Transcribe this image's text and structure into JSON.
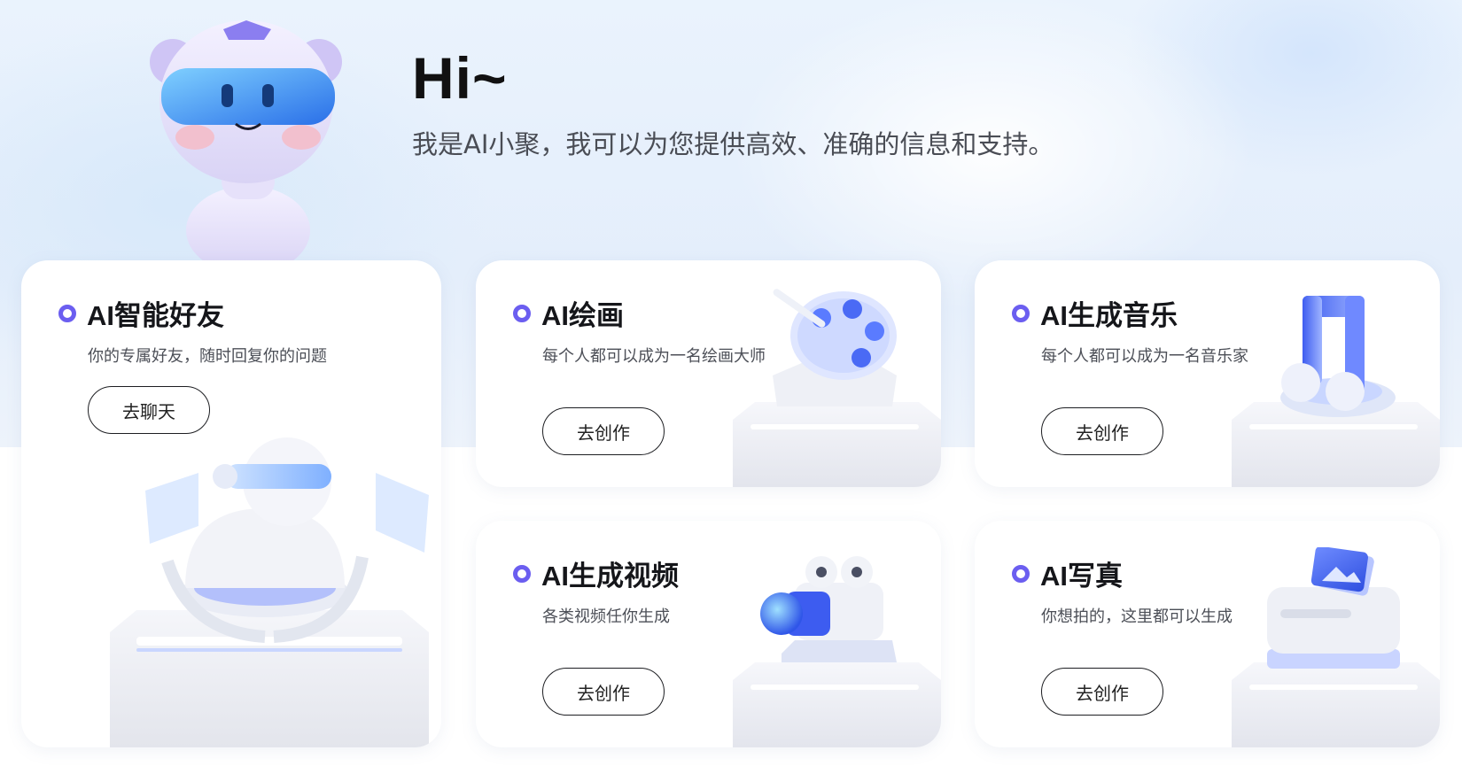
{
  "hero": {
    "greeting": "Hi~",
    "subtitle": "我是AI小聚，我可以为您提供高效、准确的信息和支持。"
  },
  "cards": [
    {
      "title": "AI智能好友",
      "desc": "你的专属好友，随时回复你的问题",
      "button": "去聊天",
      "icon": "robot-pedestal-icon"
    },
    {
      "title": "AI绘画",
      "desc": "每个人都可以成为一名绘画大师",
      "button": "去创作",
      "icon": "palette-icon"
    },
    {
      "title": "AI生成音乐",
      "desc": "每个人都可以成为一名音乐家",
      "button": "去创作",
      "icon": "music-note-icon"
    },
    {
      "title": "AI生成视频",
      "desc": "各类视频任你生成",
      "button": "去创作",
      "icon": "video-camera-icon"
    },
    {
      "title": "AI写真",
      "desc": "你想拍的，这里都可以生成",
      "button": "去创作",
      "icon": "photo-printer-icon"
    }
  ],
  "colors": {
    "accent": "#6b5ef0",
    "blue": "#3d5cf0",
    "text": "#15161a"
  }
}
